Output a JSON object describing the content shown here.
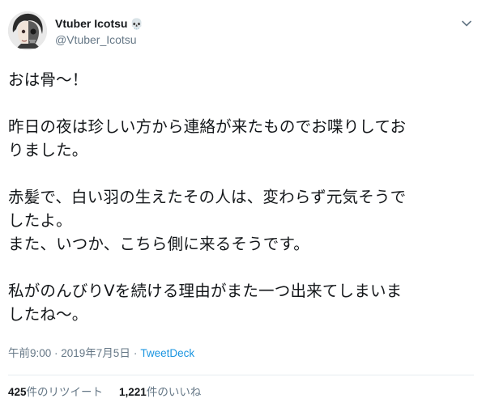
{
  "tweet": {
    "display_name": "Vtuber Icotsu",
    "name_emoji": "💀",
    "handle": "@Vtuber_Icotsu",
    "body": "おは骨～！\n\n昨日の夜は珍しい方から連絡が来たものでお喋りしてお\nりました。\n\n赤髪で、白い羽の生えたその人は、変わらず元気そうで\nしたよ。\nまた、いつか、こちら側に来るそうです。\n\n私がのんびりVを続ける理由がまた一つ出来てしまいま\nしたね～。",
    "timestamp": "午前9:00 · 2019年7月5日",
    "separator": "·",
    "source": "TweetDeck",
    "retweets_count": "425",
    "retweets_label": "件のリツイート",
    "likes_count": "1,221",
    "likes_label": "件のいいね"
  },
  "icons": {
    "avatar": "skull-face-avatar",
    "menu": "chevron-down-icon"
  },
  "colors": {
    "text": "#14171a",
    "secondary": "#657786",
    "link": "#1b95e0",
    "divider": "#e6ecf0"
  }
}
